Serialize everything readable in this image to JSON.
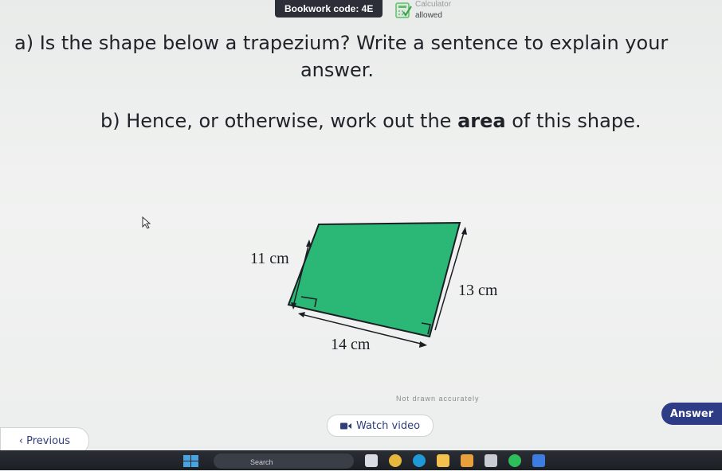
{
  "header": {
    "bookwork_code": "Bookwork code: 4E",
    "calculator_top": "Calculator",
    "calculator_status": "allowed"
  },
  "question": {
    "part_a_line1": "a) Is the shape below a trapezium? Write a sentence to explain your",
    "part_a_line2": "answer.",
    "part_b_prefix": "b) Hence, or otherwise, work out the ",
    "part_b_bold": "area",
    "part_b_suffix": " of this shape."
  },
  "diagram": {
    "label_left": "11 cm",
    "label_right": "13 cm",
    "label_bottom": "14 cm",
    "fill_color": "#2bb877",
    "stroke_color": "#1b1f24"
  },
  "footer": {
    "hint": "Not drawn accurately",
    "watch_video": "Watch video",
    "answer": "Answer",
    "previous": "Previous"
  },
  "taskbar": {
    "search": "Search"
  },
  "colors": {
    "accent": "#2e3c86",
    "calculator_green": "#5fbf6b"
  }
}
